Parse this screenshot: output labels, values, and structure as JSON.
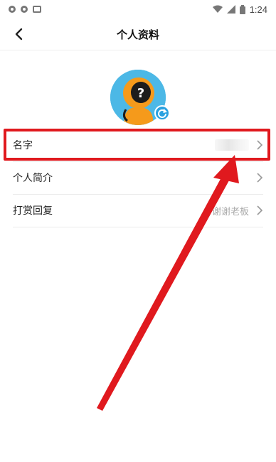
{
  "status_bar": {
    "time": "1:24",
    "icons": [
      "notification-dot-icon",
      "notification-dot-icon",
      "app-notification-icon",
      "wifi-icon",
      "signal-icon",
      "battery-icon"
    ]
  },
  "header": {
    "title": "个人资料",
    "back_icon": "chevron-left-icon"
  },
  "avatar": {
    "badge_icon": "refresh-icon",
    "colors": {
      "background": "#4cb8e6",
      "figure": "#f59a1b",
      "badge": "#2aa1e0"
    }
  },
  "rows": [
    {
      "label": "名字",
      "value": "",
      "icon": "chevron-right-icon"
    },
    {
      "label": "个人简介",
      "value": "",
      "icon": "chevron-right-icon"
    },
    {
      "label": "打赏回复",
      "value": "谢谢老板",
      "icon": "chevron-right-icon"
    }
  ],
  "annotation": {
    "highlight_color": "#e0191e",
    "arrow_color": "#e0191e"
  }
}
